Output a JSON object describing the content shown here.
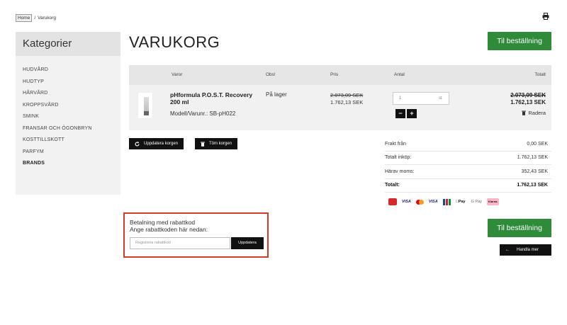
{
  "breadcrumb": {
    "home": "Home",
    "separator": "/",
    "current": "Varukorg"
  },
  "sidebar": {
    "title": "Kategorier",
    "items": [
      {
        "label": "HUDVÅRD"
      },
      {
        "label": "HUDTYP"
      },
      {
        "label": "HÅRVÅRD"
      },
      {
        "label": "KROPPSVÅRD"
      },
      {
        "label": "SMINK"
      },
      {
        "label": "FRANSAR OCH ÖGONBRYN"
      },
      {
        "label": "KOSTTILLSKOTT"
      },
      {
        "label": "PARFYM"
      },
      {
        "label": "BRANDS"
      }
    ]
  },
  "page": {
    "title": "VARUKORG",
    "checkout_label": "Til beställning"
  },
  "table": {
    "headers": {
      "items": "Varor",
      "note": "Obs!",
      "price": "Pris",
      "quantity": "Antal",
      "total": "Totalt"
    }
  },
  "cart_item": {
    "name": "pHformula P.O.S.T. Recovery 200 ml",
    "sku": "Modell/Varunr.: SB-pH022",
    "stock": "På lager",
    "price_old": "2.073,09 SEK",
    "price_new": "1.762,13 SEK",
    "quantity": "1",
    "unit": "st",
    "minus": "−",
    "plus": "+",
    "total_old": "2.073,09 SEK",
    "total_new": "1.762,13 SEK",
    "remove_label": "Radera"
  },
  "actions": {
    "update_cart": "Uppdatera korgen",
    "empty_cart": "Töm korgen"
  },
  "summary": {
    "rows": [
      {
        "label": "Frakt från",
        "value": "0,00 SEK"
      },
      {
        "label": "Totalt inköp:",
        "value": "1.762,13 SEK"
      },
      {
        "label": "Härav moms:",
        "value": "352,43 SEK"
      },
      {
        "label": "Totalt:",
        "value": "1.762,13 SEK"
      }
    ]
  },
  "payments": [
    "Dankort",
    "VISA",
    "Mastercard",
    "VISA",
    "JCB",
    "Apple Pay",
    "G Pay",
    "Klarna"
  ],
  "payment_text": {
    "visa1": "VISA",
    "visa2": "VISA",
    "apple": "Pay",
    "gpay": "G Pay",
    "klarna": "Klarna."
  },
  "coupon": {
    "line1": "Betalning med rabattkod",
    "line2": "Ange rabattkoden här nedan:",
    "placeholder": "Registrera rabattkod",
    "button": "Uppdatera"
  },
  "continue_shopping": {
    "arrow": "←",
    "label": "Handla mer"
  },
  "colors": {
    "green": "#2e8b3a",
    "highlight": "#d23b2a",
    "dark": "#111111"
  }
}
